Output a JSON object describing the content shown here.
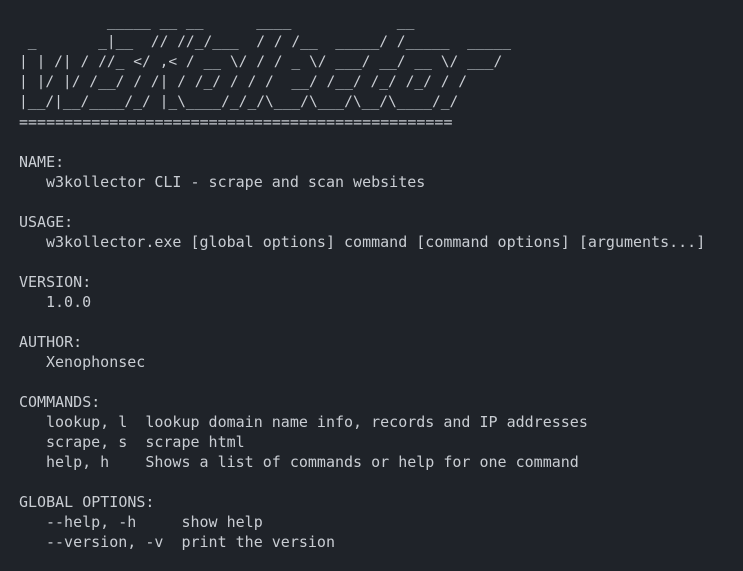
{
  "banner": {
    "ascii": "          _____ __ __      ____            __\n _       _|__  // //_/___  / / /__  _____/ /_____  _____\n| | /| / //_ </ ,< / __ \\/ / / _ \\/ ___/ __/ __ \\/ ___/\n| |/ |/ /__/ / /| / /_/ / / /  __/ /__/ /_/ /_/ / /\n|__/|__/____/_/ |_\\____/_/_/\\___/\\___/\\__/\\____/_/",
    "rule": "================================================"
  },
  "help": {
    "name_heading": "NAME:",
    "name_value": "w3kollector CLI - scrape and scan websites",
    "usage_heading": "USAGE:",
    "usage_value": "w3kollector.exe [global options] command [command options] [arguments...]",
    "version_heading": "VERSION:",
    "version_value": "1.0.0",
    "author_heading": "AUTHOR:",
    "author_value": "Xenophonsec",
    "commands_heading": "COMMANDS:",
    "commands": [
      {
        "name": "lookup, l",
        "desc": "lookup domain name info, records and IP addresses"
      },
      {
        "name": "scrape, s",
        "desc": "scrape html"
      },
      {
        "name": "help, h  ",
        "desc": "Shows a list of commands or help for one command"
      }
    ],
    "global_options_heading": "GLOBAL OPTIONS:",
    "global_options": [
      {
        "flag": "--help, -h   ",
        "desc": "show help"
      },
      {
        "flag": "--version, -v",
        "desc": "print the version"
      }
    ]
  },
  "colors": {
    "background": "#1f2329",
    "text": "#c9cdd3"
  }
}
